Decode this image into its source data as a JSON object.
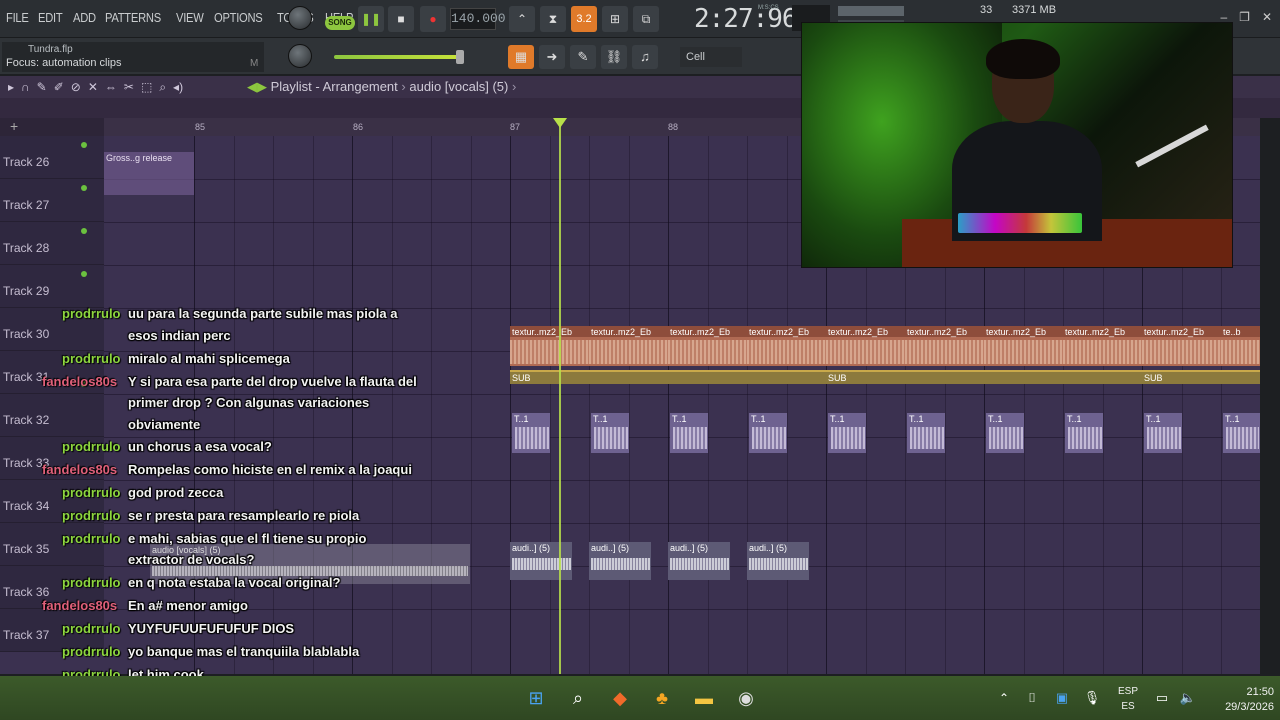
{
  "menu": [
    "FILE",
    "EDIT",
    "ADD",
    "PATTERNS",
    "VIEW",
    "OPTIONS",
    "TOOLS",
    "HELP"
  ],
  "transport": {
    "mode": "SONG",
    "tempo": "140.000",
    "time": "2:27:96",
    "time_label": "M:S:CS",
    "pattern_box": "3.2",
    "cpu": "33",
    "memory": "3371 MB"
  },
  "project": {
    "filename": "Tundra.flp",
    "hint": "Focus: automation clips",
    "hint_suffix": "M"
  },
  "snap": {
    "label": "Cell"
  },
  "playlist": {
    "title": "Playlist - Arrangement",
    "breadcrumb": "audio [vocals] (5)",
    "ruler": [
      "85",
      "86",
      "87",
      "88"
    ]
  },
  "tracks": [
    "Track 26",
    "Track 27",
    "Track 28",
    "Track 29",
    "Track 30",
    "Track 31",
    "Track 32",
    "Track 33",
    "Track 34",
    "Track 35",
    "Track 36",
    "Track 37"
  ],
  "clips": {
    "automation": "Gross..g release",
    "texture": "textur..mz2_Eb",
    "texture_tail": "te..b",
    "sub": "SUB",
    "t1": "T..1",
    "audio": "audi..] (5)",
    "audio_ghost": "audio [vocals] (5)"
  },
  "chat": [
    {
      "user": "prodrrulo",
      "msg": "uu para la segunda parte subile mas piola a",
      "color": "#8dd63f"
    },
    {
      "user": "",
      "msg": "esos indian perc",
      "color": "#8dd63f"
    },
    {
      "user": "prodrrulo",
      "msg": "miralo al mahi splicemega",
      "color": "#8dd63f"
    },
    {
      "user": "fandelos80s",
      "msg": "Y si para esa parte del drop vuelve la flauta del",
      "color": "#e0607a"
    },
    {
      "user": "",
      "msg": "primer drop ? Con algunas variaciones",
      "color": "#e0607a"
    },
    {
      "user": "",
      "msg": "obviamente",
      "color": "#e0607a"
    },
    {
      "user": "prodrrulo",
      "msg": "un chorus a esa vocal?",
      "color": "#8dd63f"
    },
    {
      "user": "fandelos80s",
      "msg": "Rompelas como hiciste en el remix a la joaqui",
      "color": "#e0607a"
    },
    {
      "user": "prodrrulo",
      "msg": "god prod zecca",
      "color": "#8dd63f"
    },
    {
      "user": "prodrrulo",
      "msg": "se r presta para resamplearlo re piola",
      "color": "#8dd63f"
    },
    {
      "user": "prodrrulo",
      "msg": "e mahi, sabias que el fl tiene su propio",
      "color": "#8dd63f"
    },
    {
      "user": "",
      "msg": "extractor de vocals?",
      "color": "#8dd63f"
    },
    {
      "user": "prodrrulo",
      "msg": "en q nota estaba la vocal original?",
      "color": "#8dd63f"
    },
    {
      "user": "fandelos80s",
      "msg": "En a# menor amigo",
      "color": "#e0607a"
    },
    {
      "user": "prodrrulo",
      "msg": "YUYFUFUUFUFUFUF DIOS",
      "color": "#8dd63f"
    },
    {
      "user": "prodrrulo",
      "msg": "yo banque mas el tranquiila blablabla",
      "color": "#8dd63f"
    },
    {
      "user": "prodrrulo",
      "msg": "let him cook",
      "color": "#8dd63f"
    }
  ],
  "taskbar": {
    "lang_top": "ESP",
    "lang_bottom": "ES",
    "time": "21:50",
    "date": "29/3/2026"
  }
}
